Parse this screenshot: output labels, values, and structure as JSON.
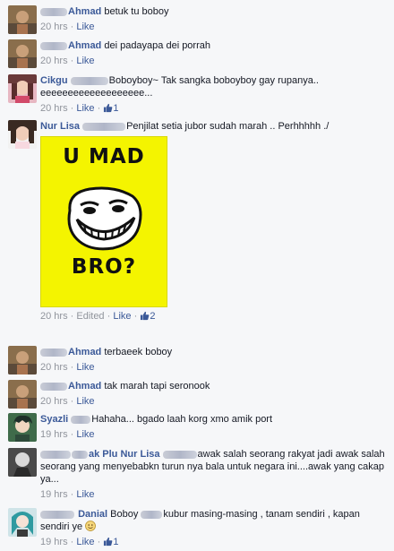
{
  "colors": {
    "link": "#3b5998",
    "meta": "#90949c",
    "text": "#141823",
    "background": "#f6f7f9",
    "meme_bg": "#f4f400"
  },
  "actions": {
    "like": "Like",
    "separator": " · "
  },
  "comments": [
    {
      "name": "Ahmad",
      "text": "betuk tu boboy",
      "time": "20 hrs",
      "avatar": "person-photo-brown"
    },
    {
      "name": "Ahmad",
      "text": "dei padayapa dei porrah",
      "time": "20 hrs",
      "avatar": "person-photo-brown"
    },
    {
      "name": "Cikgu",
      "text": "Boboyboy~ Tak sangka boboyboy gay rupanya.. eeeeeeeeeeeeeeeeeee...",
      "time": "20 hrs",
      "likes": "1",
      "avatar": "girl-photo-pink"
    },
    {
      "name": "Nur Lisa",
      "text": "Penjilat setia jubor sudah marah .. Perhhhhh ./",
      "time": "20 hrs",
      "edited": "Edited",
      "likes": "2",
      "avatar": "girl-photo-white",
      "meme": {
        "top": "U MAD",
        "bottom": "BRO?",
        "icon": "trollface-icon"
      }
    },
    {
      "name": "Ahmad",
      "text": "terbaeek boboy",
      "time": "20 hrs",
      "avatar": "person-photo-brown"
    },
    {
      "name": "Ahmad",
      "text": "tak marah tapi seronook",
      "time": "20 hrs",
      "avatar": "person-photo-brown"
    },
    {
      "name": "Syazli",
      "text": "Hahaha... bgado laah korg xmo amik port",
      "time": "19 hrs",
      "avatar": "anime-avatar-green"
    },
    {
      "name_prefix": "ak Plu",
      "name": "Nur Lisa",
      "text": "awak salah seorang rakyat jadi awak salah seorang yang menyebabkn turun nya bala untuk negara ini....awak yang cakap ya...",
      "time": "19 hrs",
      "avatar": "avatar-dark"
    },
    {
      "name": "Danial",
      "tag": "Boboy",
      "text": "kubur masing-masing , tanam sendiri , kapan sendiri ye",
      "emoji": "smile-icon",
      "time": "19 hrs",
      "likes": "1",
      "avatar": "anime-avatar-teal"
    }
  ]
}
